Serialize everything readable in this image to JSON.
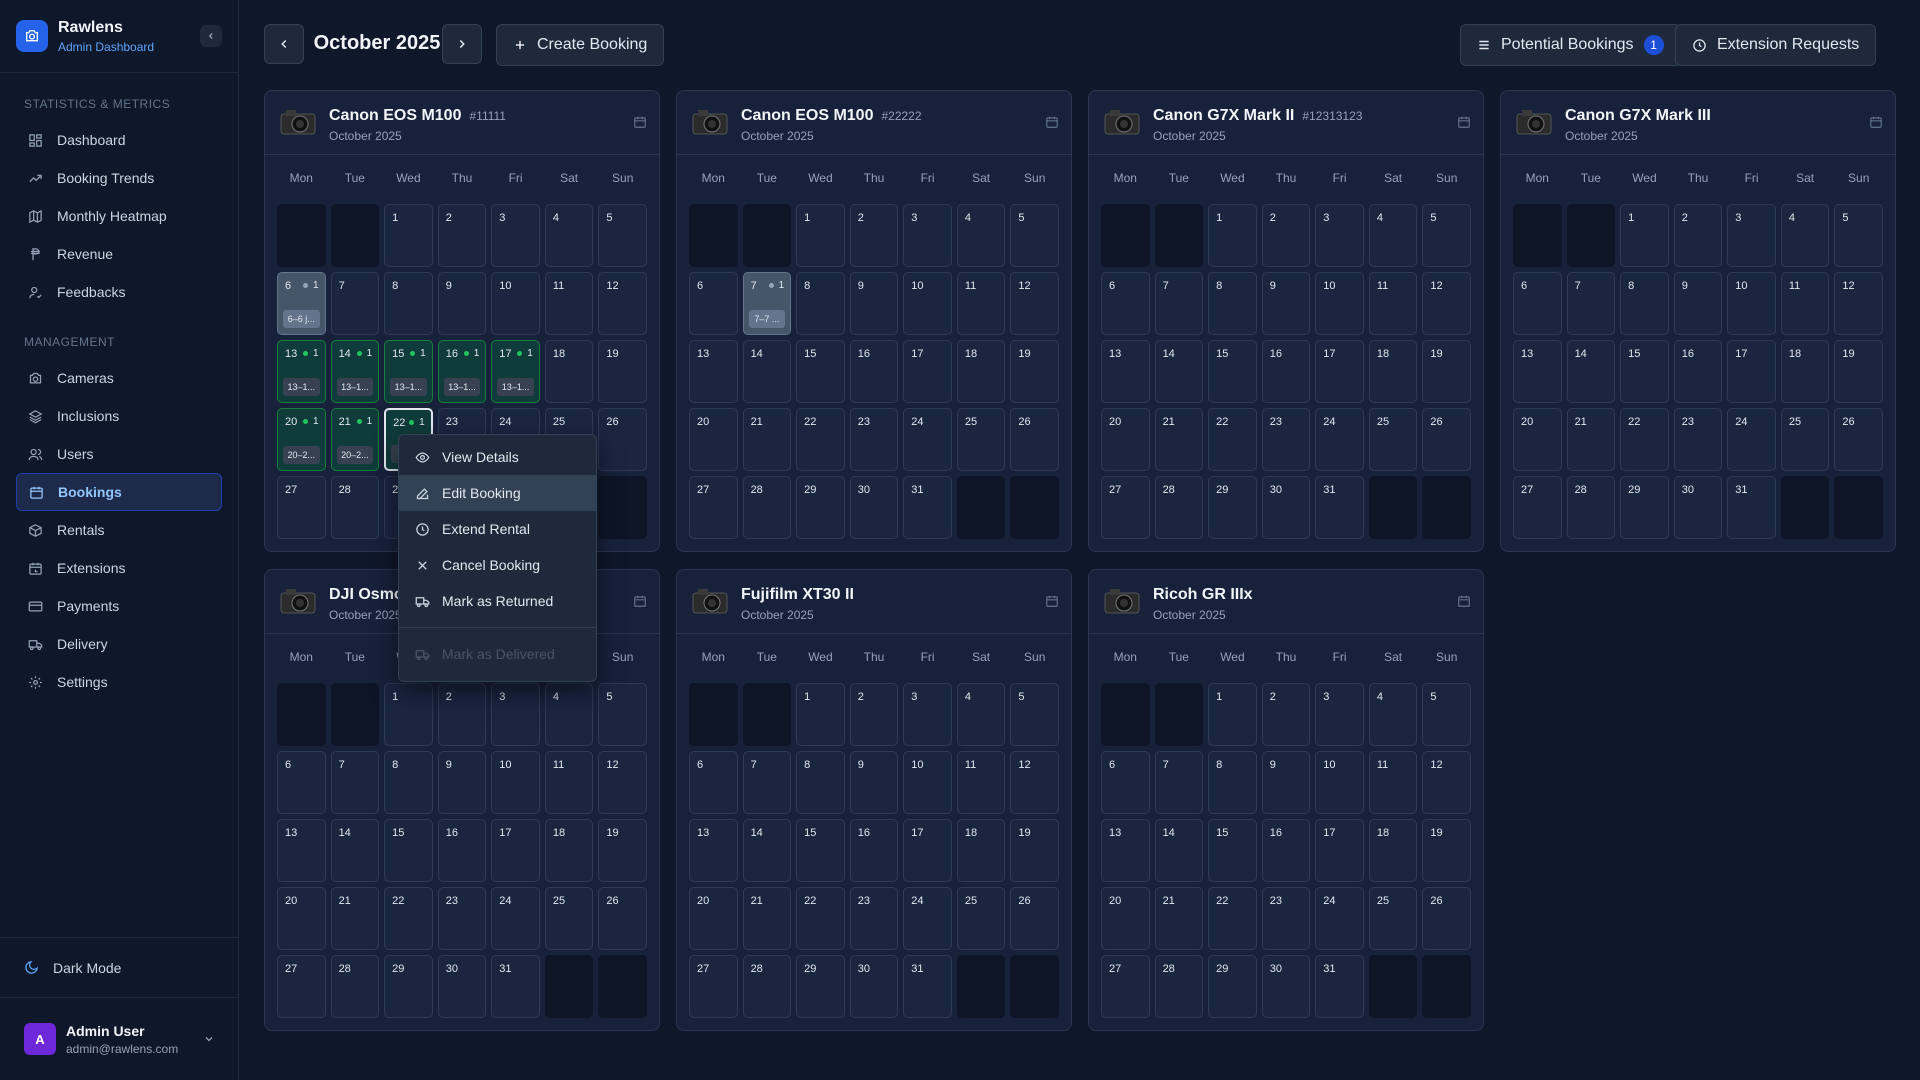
{
  "brand": {
    "name": "Rawlens",
    "subtitle": "Admin Dashboard"
  },
  "sidebar": {
    "sections": [
      {
        "title": "STATISTICS & METRICS",
        "items": [
          "Dashboard",
          "Booking Trends",
          "Monthly Heatmap",
          "Revenue",
          "Feedbacks"
        ]
      },
      {
        "title": "MANAGEMENT",
        "items": [
          "Cameras",
          "Inclusions",
          "Users",
          "Bookings",
          "Rentals",
          "Extensions",
          "Payments",
          "Delivery",
          "Settings"
        ]
      }
    ],
    "active_item": "Bookings",
    "dark_mode_label": "Dark Mode",
    "user": {
      "initial": "A",
      "name": "Admin User",
      "email": "admin@rawlens.com"
    }
  },
  "header": {
    "month": "October 2025",
    "create_label": "Create Booking",
    "potential_label": "Potential Bookings",
    "potential_count": "1",
    "extension_label": "Extension Requests"
  },
  "weekdays": [
    "Mon",
    "Tue",
    "Wed",
    "Thu",
    "Fri",
    "Sat",
    "Sun"
  ],
  "calendars": [
    {
      "name": "Canon EOS M100",
      "serial": "#11111",
      "month": "October 2025",
      "bookings": [
        {
          "day": 6,
          "status": "pending",
          "count": "1",
          "label": "6–6 j..."
        },
        {
          "day": 13,
          "status": "booked",
          "count": "1",
          "label": "13–1..."
        },
        {
          "day": 14,
          "status": "booked",
          "count": "1",
          "label": "13–1..."
        },
        {
          "day": 15,
          "status": "booked",
          "count": "1",
          "label": "13–1..."
        },
        {
          "day": 16,
          "status": "booked",
          "count": "1",
          "label": "13–1..."
        },
        {
          "day": 17,
          "status": "booked",
          "count": "1",
          "label": "13–1..."
        },
        {
          "day": 20,
          "status": "booked",
          "count": "1",
          "label": "20–2..."
        },
        {
          "day": 21,
          "status": "booked",
          "count": "1",
          "label": "20–2..."
        },
        {
          "day": 22,
          "status": "booked",
          "count": "1",
          "label": "2...",
          "selected": true
        }
      ]
    },
    {
      "name": "Canon EOS M100",
      "serial": "#22222",
      "month": "October 2025",
      "bookings": [
        {
          "day": 7,
          "status": "pending",
          "count": "1",
          "label": "7–7 ..."
        }
      ]
    },
    {
      "name": "Canon G7X Mark II",
      "serial": "#12313123",
      "month": "October 2025",
      "bookings": []
    },
    {
      "name": "Canon G7X Mark III",
      "serial": "",
      "month": "October 2025",
      "bookings": []
    },
    {
      "name": "DJI Osmo",
      "serial": "",
      "month": "October 2025",
      "bookings": []
    },
    {
      "name": "Fujifilm XT30 II",
      "serial": "",
      "month": "October 2025",
      "bookings": []
    },
    {
      "name": "Ricoh GR IIIx",
      "serial": "",
      "month": "October 2025",
      "bookings": []
    }
  ],
  "context_menu": {
    "items": [
      "View Details",
      "Edit Booking",
      "Extend Rental",
      "Cancel Booking",
      "Mark as Returned"
    ],
    "hovered": "Edit Booking",
    "disabled_item": "Mark as Delivered"
  },
  "colors": {
    "accent": "#2563eb",
    "booked": "#15803d",
    "pending": "#64748b",
    "badge": "#1d4ed8"
  }
}
